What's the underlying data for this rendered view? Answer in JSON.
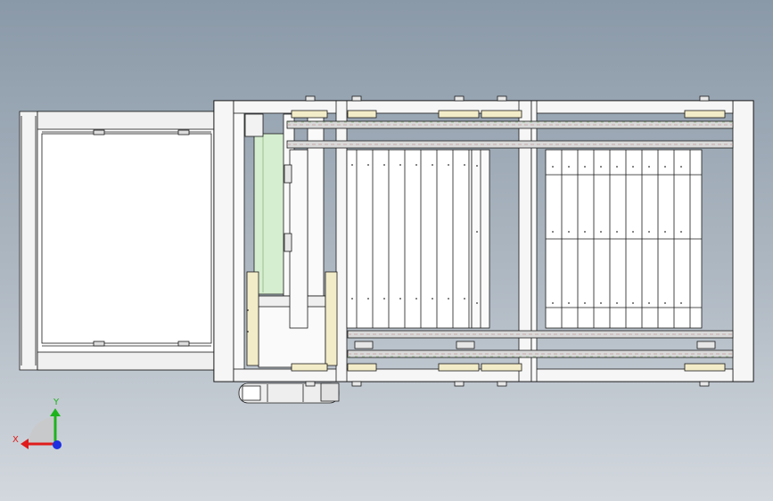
{
  "viewport": {
    "background_top": "#8a99a8",
    "background_bottom": "#d3d8de",
    "line_color": "#1a1a1a",
    "part_fill": "#ffffff"
  },
  "model": {
    "highlight_color": "#cfe8c6",
    "bracket_color": "#f3ecc8",
    "chain_color": "#6d6d6d",
    "chain_accent": "#c49a9a"
  },
  "triad": {
    "x_label": "X",
    "y_label": "Y",
    "x_color": "#e01b1b",
    "y_color": "#1db31d",
    "z_color": "#1e2fe0"
  }
}
